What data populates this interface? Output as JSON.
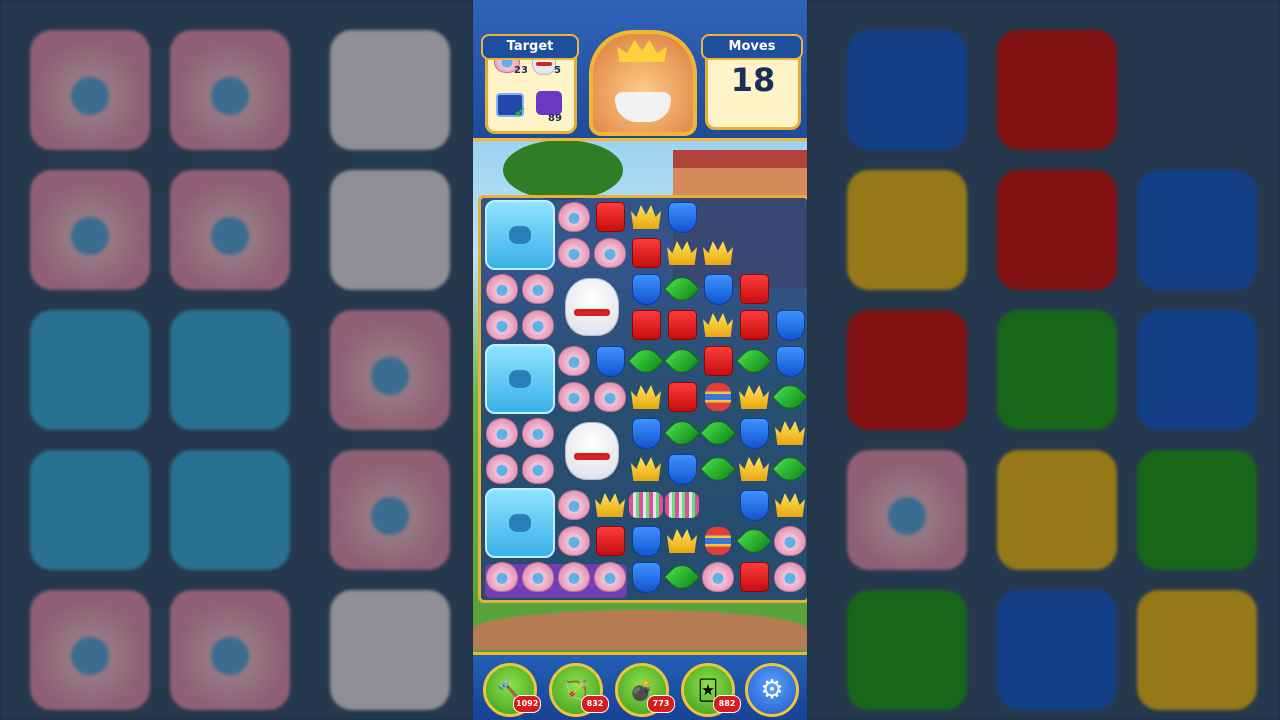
{
  "header": {
    "target_label": "Target",
    "moves_label": "Moves",
    "moves_value": "18",
    "targets": [
      {
        "icon": "shell-icon",
        "count": "23"
      },
      {
        "icon": "bear-icon",
        "count": "5"
      },
      {
        "icon": "tv-icon",
        "count": "",
        "done": true
      },
      {
        "icon": "purple-tile-icon",
        "count": "89"
      }
    ]
  },
  "boosters": [
    {
      "icon": "hammer-icon",
      "count": "1092"
    },
    {
      "icon": "arrow-icon",
      "count": "832"
    },
    {
      "icon": "cannon-icon",
      "count": "773"
    },
    {
      "icon": "jester-hat-icon",
      "count": "882"
    }
  ],
  "settings_icon": "gear-icon",
  "colors": {
    "frame_gold": "#f1b632",
    "header_blue": "#1e4b99",
    "board_blue": "#1c3c78"
  }
}
